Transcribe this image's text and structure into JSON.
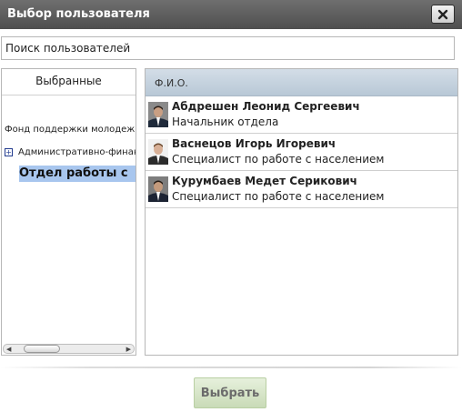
{
  "dialog": {
    "title": "Выбор пользователя"
  },
  "search": {
    "placeholder": "Поиск пользователей",
    "value": ""
  },
  "left_panel": {
    "header": "Выбранные",
    "tree": {
      "root": "Фонд поддержки молодежи",
      "items": [
        {
          "label": "Административно-финансовый",
          "expand_icon": "plus-box-icon"
        },
        {
          "label": "Отдел работы с",
          "selected": true
        }
      ]
    }
  },
  "users_table": {
    "column_header": "Ф.И.О.",
    "rows": [
      {
        "name": "Абдрешен Леонид Сергеевич",
        "role": "Начальник отдела",
        "avatar": "user-photo-icon"
      },
      {
        "name": "Васнецов Игорь Игоревич",
        "role": "Специалист по работе с населением",
        "avatar": "user-photo-icon"
      },
      {
        "name": "Курумбаев Медет Серикович",
        "role": "Специалист по работе с населением",
        "avatar": "user-photo-icon"
      }
    ]
  },
  "footer": {
    "choose_label": "Выбрать"
  },
  "colors": {
    "titlebar": "#5e5e5e",
    "selected_item": "#a8c6ee",
    "table_header": "#c6d4e0",
    "choose_button": "#d6e5c8"
  }
}
